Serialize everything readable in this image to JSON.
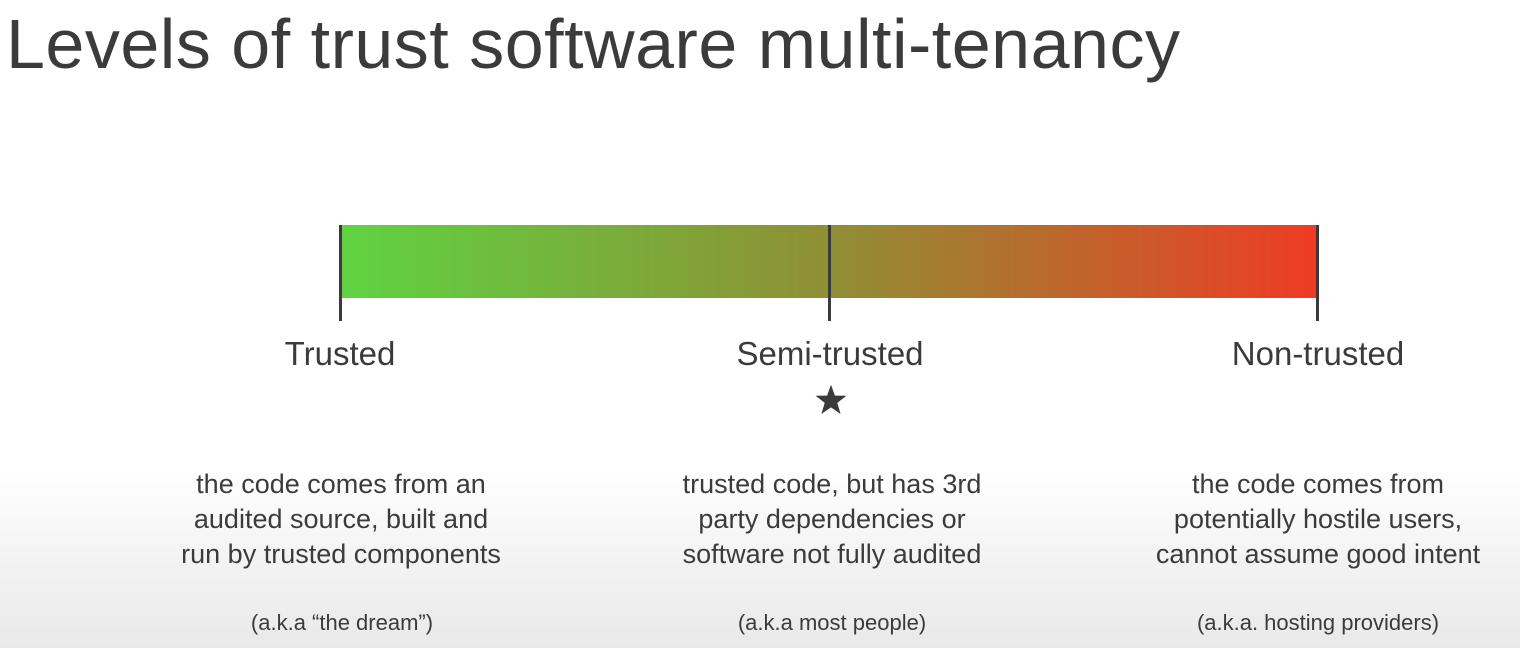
{
  "title": "Levels of trust software multi-tenancy",
  "scale": {
    "gradient_colors": [
      "#5fd342",
      "#8f8f34",
      "#ef3b24"
    ],
    "tick_color": "#3a3a3a"
  },
  "levels": [
    {
      "label": "Trusted",
      "description": [
        "the code comes from an",
        "audited source, built and",
        "run by trusted components"
      ],
      "aka": "(a.k.a “the dream”)"
    },
    {
      "label": "Semi-trusted",
      "marker": "star-icon",
      "description": [
        "trusted code, but has 3rd",
        "party dependencies or",
        "software not fully audited"
      ],
      "aka": "(a.k.a most people)"
    },
    {
      "label": "Non-trusted",
      "description": [
        "the code comes from",
        "potentially hostile users,",
        "cannot assume good intent"
      ],
      "aka": "(a.k.a. hosting providers)"
    }
  ]
}
